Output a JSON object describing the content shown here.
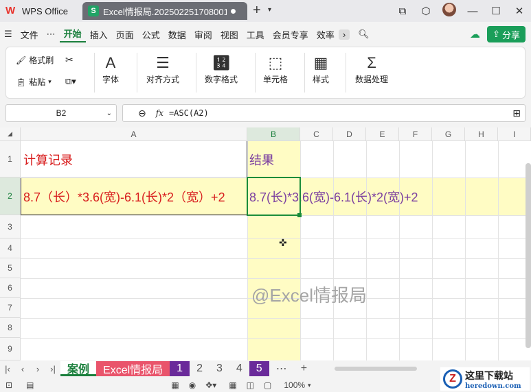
{
  "titlebar": {
    "app_name": "WPS Office",
    "doc_title": "Excel情报局.202502251708001"
  },
  "menu": {
    "file": "文件",
    "more": "⋯",
    "items": [
      "开始",
      "插入",
      "页面",
      "公式",
      "数据",
      "审阅",
      "视图",
      "工具",
      "会员专享",
      "效率"
    ],
    "share": "分享"
  },
  "ribbon": {
    "format_painter": "格式刷",
    "paste": "粘贴",
    "font": "字体",
    "align": "对齐方式",
    "number_format": "数字格式",
    "cell": "单元格",
    "style": "样式",
    "data_process": "数据处理"
  },
  "formula_bar": {
    "name_box": "B2",
    "fx": "fx",
    "formula": "=ASC(A2)"
  },
  "grid": {
    "columns": [
      "A",
      "B",
      "C",
      "D",
      "E",
      "F",
      "G",
      "H",
      "I"
    ],
    "rows": [
      "1",
      "2",
      "3",
      "4",
      "5",
      "6",
      "7",
      "8",
      "9"
    ],
    "a1": "计算记录",
    "b1": "结果",
    "a2": "8.7（长）*3.6(宽)-6.1(长)*2（宽）+2",
    "b2": "8.7(长)*3.6(宽)-6.1(长)*2(宽)+2",
    "watermark": "@Excel情报局"
  },
  "sheets": {
    "tabs": [
      "案例",
      "Excel情报局",
      "1",
      "2",
      "3",
      "4",
      "5"
    ],
    "more": "⋯",
    "add": "+"
  },
  "status": {
    "zoom": "100%",
    "brand_cn": "这里下载站",
    "brand_en": "heredown.com"
  },
  "colors": {
    "accent": "#1a7f3c",
    "yellow_fill": "#fffcc4",
    "red_text": "#d81e1e",
    "purple_text": "#7b3fa0"
  }
}
